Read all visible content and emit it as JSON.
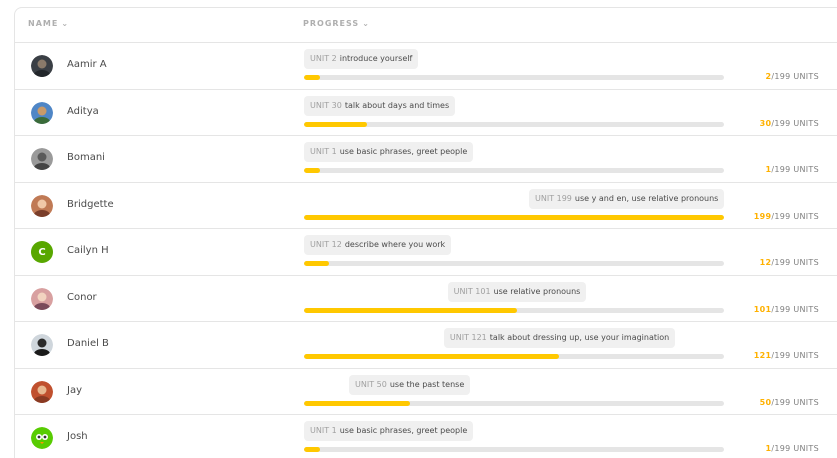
{
  "header": {
    "name_label": "NAME",
    "progress_label": "PROGRESS"
  },
  "total_units_label": "/199 UNITS",
  "total_units": 199,
  "colors": {
    "progress_fill": "#ffc800",
    "progress_track": "#e5e5e5",
    "count_accent": "#ffb100"
  },
  "students": [
    {
      "name": "Aamir A",
      "avatar": "photo",
      "unit_label": "UNIT 2",
      "unit_title": "introduce yourself",
      "completed": "2"
    },
    {
      "name": "Aditya",
      "avatar": "photo",
      "unit_label": "UNIT 30",
      "unit_title": "talk about days and times",
      "completed": "30"
    },
    {
      "name": "Bomani",
      "avatar": "photo",
      "unit_label": "UNIT 1",
      "unit_title": "use basic phrases, greet people",
      "completed": "1"
    },
    {
      "name": "Bridgette",
      "avatar": "photo",
      "unit_label": "UNIT 199",
      "unit_title": "use y and en, use relative pronouns",
      "completed": "199"
    },
    {
      "name": "Cailyn H",
      "avatar": "letter",
      "avatar_letter": "C",
      "unit_label": "UNIT 12",
      "unit_title": "describe where you work",
      "completed": "12"
    },
    {
      "name": "Conor",
      "avatar": "photo",
      "unit_label": "UNIT 101",
      "unit_title": "use relative pronouns",
      "completed": "101"
    },
    {
      "name": "Daniel B",
      "avatar": "photo",
      "unit_label": "UNIT 121",
      "unit_title": "talk about dressing up, use your imagination",
      "completed": "121"
    },
    {
      "name": "Jay",
      "avatar": "photo",
      "unit_label": "UNIT 50",
      "unit_title": "use the past tense",
      "completed": "50"
    },
    {
      "name": "Josh",
      "avatar": "photo",
      "unit_label": "UNIT 1",
      "unit_title": "use basic phrases, greet people",
      "completed": "1"
    }
  ]
}
